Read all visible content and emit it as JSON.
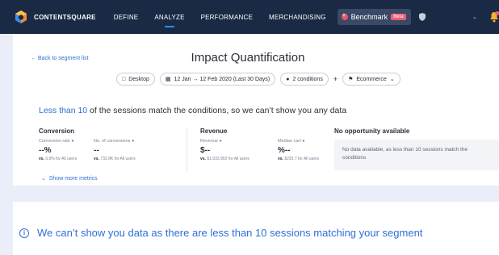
{
  "nav": {
    "brand": "CONTENTSQUARE",
    "items": [
      "DEFINE",
      "ANALYZE",
      "PERFORMANCE",
      "MERCHANDISING"
    ],
    "active": "ANALYZE",
    "benchmark_label": "Benchmark",
    "beta_label": "Beta"
  },
  "page": {
    "back_link": "← Back to segment list",
    "title": "Impact Quantification",
    "filters": {
      "device": "Desktop",
      "date_range": "12 Jan → 12 Feb 2020 (Last 30 Days)",
      "conditions": "2 conditions",
      "plus": "+",
      "ecommerce": "Ecommerce"
    },
    "warning": {
      "highlight": "Less than 10",
      "rest": " of the sessions match the conditions, so we can’t show you any data"
    }
  },
  "conversion": {
    "title": "Conversion",
    "metrics": [
      {
        "label": "Conversion rate ●",
        "value": "--%",
        "cmp_bold": "vs.",
        "cmp": " 6.9% for All users"
      },
      {
        "label": "No. of conversions ●",
        "value": "--",
        "cmp_bold": "vs.",
        "cmp": " 732.8K for All users"
      }
    ],
    "more": "Show more metrics"
  },
  "revenue": {
    "title": "Revenue",
    "metrics": [
      {
        "label": "Revenue ●",
        "value": "$--",
        "cmp_bold": "vs.",
        "cmp": " $1,932,992 for All users"
      },
      {
        "label": "Median cart ●",
        "value": "%--",
        "cmp_bold": "vs.",
        "cmp": " $293.7 for All users"
      }
    ]
  },
  "opportunity": {
    "title": "No opportunity available",
    "message": "No data available, as less than 10 sessions match the conditions"
  },
  "banner": {
    "message": "We can’t show you data as there are less than 10 sessions matching your segment"
  },
  "colors": {
    "accent": "#2f6fd6",
    "nav_bg": "#1a2a44",
    "beta": "#ee5d7a"
  }
}
